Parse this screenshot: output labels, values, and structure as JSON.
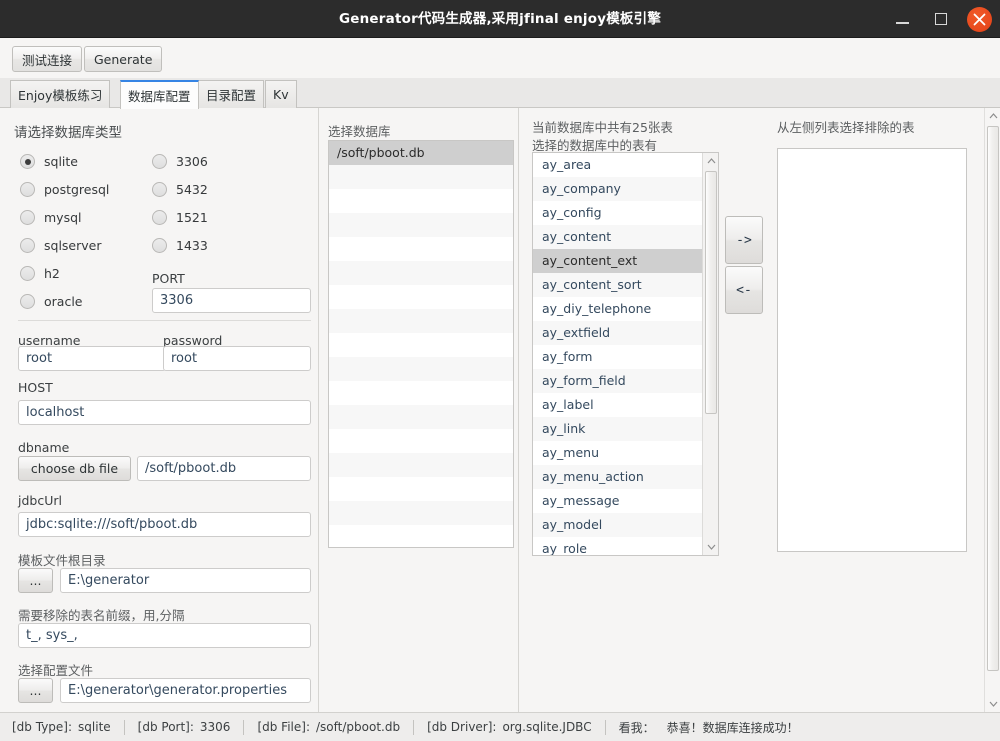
{
  "window": {
    "title": "Generator代码生成器,采用jfinal enjoy模板引擎",
    "minimize_label": "minimize",
    "maximize_label": "maximize",
    "close_label": "close"
  },
  "toolbar": {
    "test_connection_label": "测试连接",
    "generate_label": "Generate"
  },
  "tabs": [
    {
      "label": "Enjoy模板练习",
      "active": false
    },
    {
      "label": "数据库配置",
      "active": true
    },
    {
      "label": "目录配置",
      "active": false
    },
    {
      "label": "Kv",
      "active": false
    }
  ],
  "db_type_section": {
    "title": "请选择数据库类型",
    "types": [
      {
        "label": "sqlite",
        "selected": true
      },
      {
        "label": "postgresql",
        "selected": false
      },
      {
        "label": "mysql",
        "selected": false
      },
      {
        "label": "sqlserver",
        "selected": false
      },
      {
        "label": "h2",
        "selected": false
      },
      {
        "label": "oracle",
        "selected": false
      }
    ],
    "ports": [
      {
        "label": "3306",
        "selected": false
      },
      {
        "label": "5432",
        "selected": false
      },
      {
        "label": "1521",
        "selected": false
      },
      {
        "label": "1433",
        "selected": false
      }
    ],
    "port_label": "PORT",
    "port_value": "3306"
  },
  "credentials": {
    "username_label": "username",
    "username_value": "root",
    "password_label": "password",
    "password_value": "root",
    "host_label": "HOST",
    "host_value": "localhost"
  },
  "dbname_section": {
    "label": "dbname",
    "choose_button_label": "choose db file",
    "value": "/soft/pboot.db"
  },
  "jdbc_section": {
    "label": "jdbcUrl",
    "value": "jdbc:sqlite:///soft/pboot.db"
  },
  "template_root": {
    "label": "模板文件根目录",
    "browse_button_label": "...",
    "value": "E:\\generator"
  },
  "prefix_section": {
    "label": "需要移除的表名前缀，用,分隔",
    "value": "t_, sys_,"
  },
  "config_file": {
    "label": "选择配置文件",
    "browse_button_label": "...",
    "value": "E:\\generator\\generator.properties"
  },
  "db_list": {
    "title": "选择数据库",
    "items": [
      {
        "label": "/soft/pboot.db",
        "selected": true
      }
    ],
    "empty_row_count": 15
  },
  "tables_panel": {
    "count_text": "当前数据库中共有25张表",
    "subtitle": "选择的数据库中的表有",
    "selected_table": "ay_content_ext",
    "tables": [
      "ay_area",
      "ay_company",
      "ay_config",
      "ay_content",
      "ay_content_ext",
      "ay_content_sort",
      "ay_diy_telephone",
      "ay_extfield",
      "ay_form",
      "ay_form_field",
      "ay_label",
      "ay_link",
      "ay_menu",
      "ay_menu_action",
      "ay_message",
      "ay_model",
      "ay_role"
    ]
  },
  "transfer": {
    "to_right_label": "->",
    "to_left_label": "<-"
  },
  "excluded_panel": {
    "title": "从左侧列表选择排除的表",
    "items": []
  },
  "statusbar": {
    "items": [
      {
        "key": "[db Type]:",
        "value": "sqlite"
      },
      {
        "key": "[db Port]:",
        "value": "3306"
      },
      {
        "key": "[db File]:",
        "value": "/soft/pboot.db"
      },
      {
        "key": "[db Driver]:",
        "value": "org.sqlite.JDBC"
      }
    ],
    "message_prefix": "看我：",
    "message": "恭喜！数据库连接成功！"
  },
  "colors": {
    "titlebar_bg": "#2c2c2c",
    "close_button": "#e8491d",
    "active_tab_accent": "#3584e4",
    "panel_bg": "#f6f5f4",
    "selection_bg": "#cfcfcf",
    "input_text": "#34495e"
  }
}
